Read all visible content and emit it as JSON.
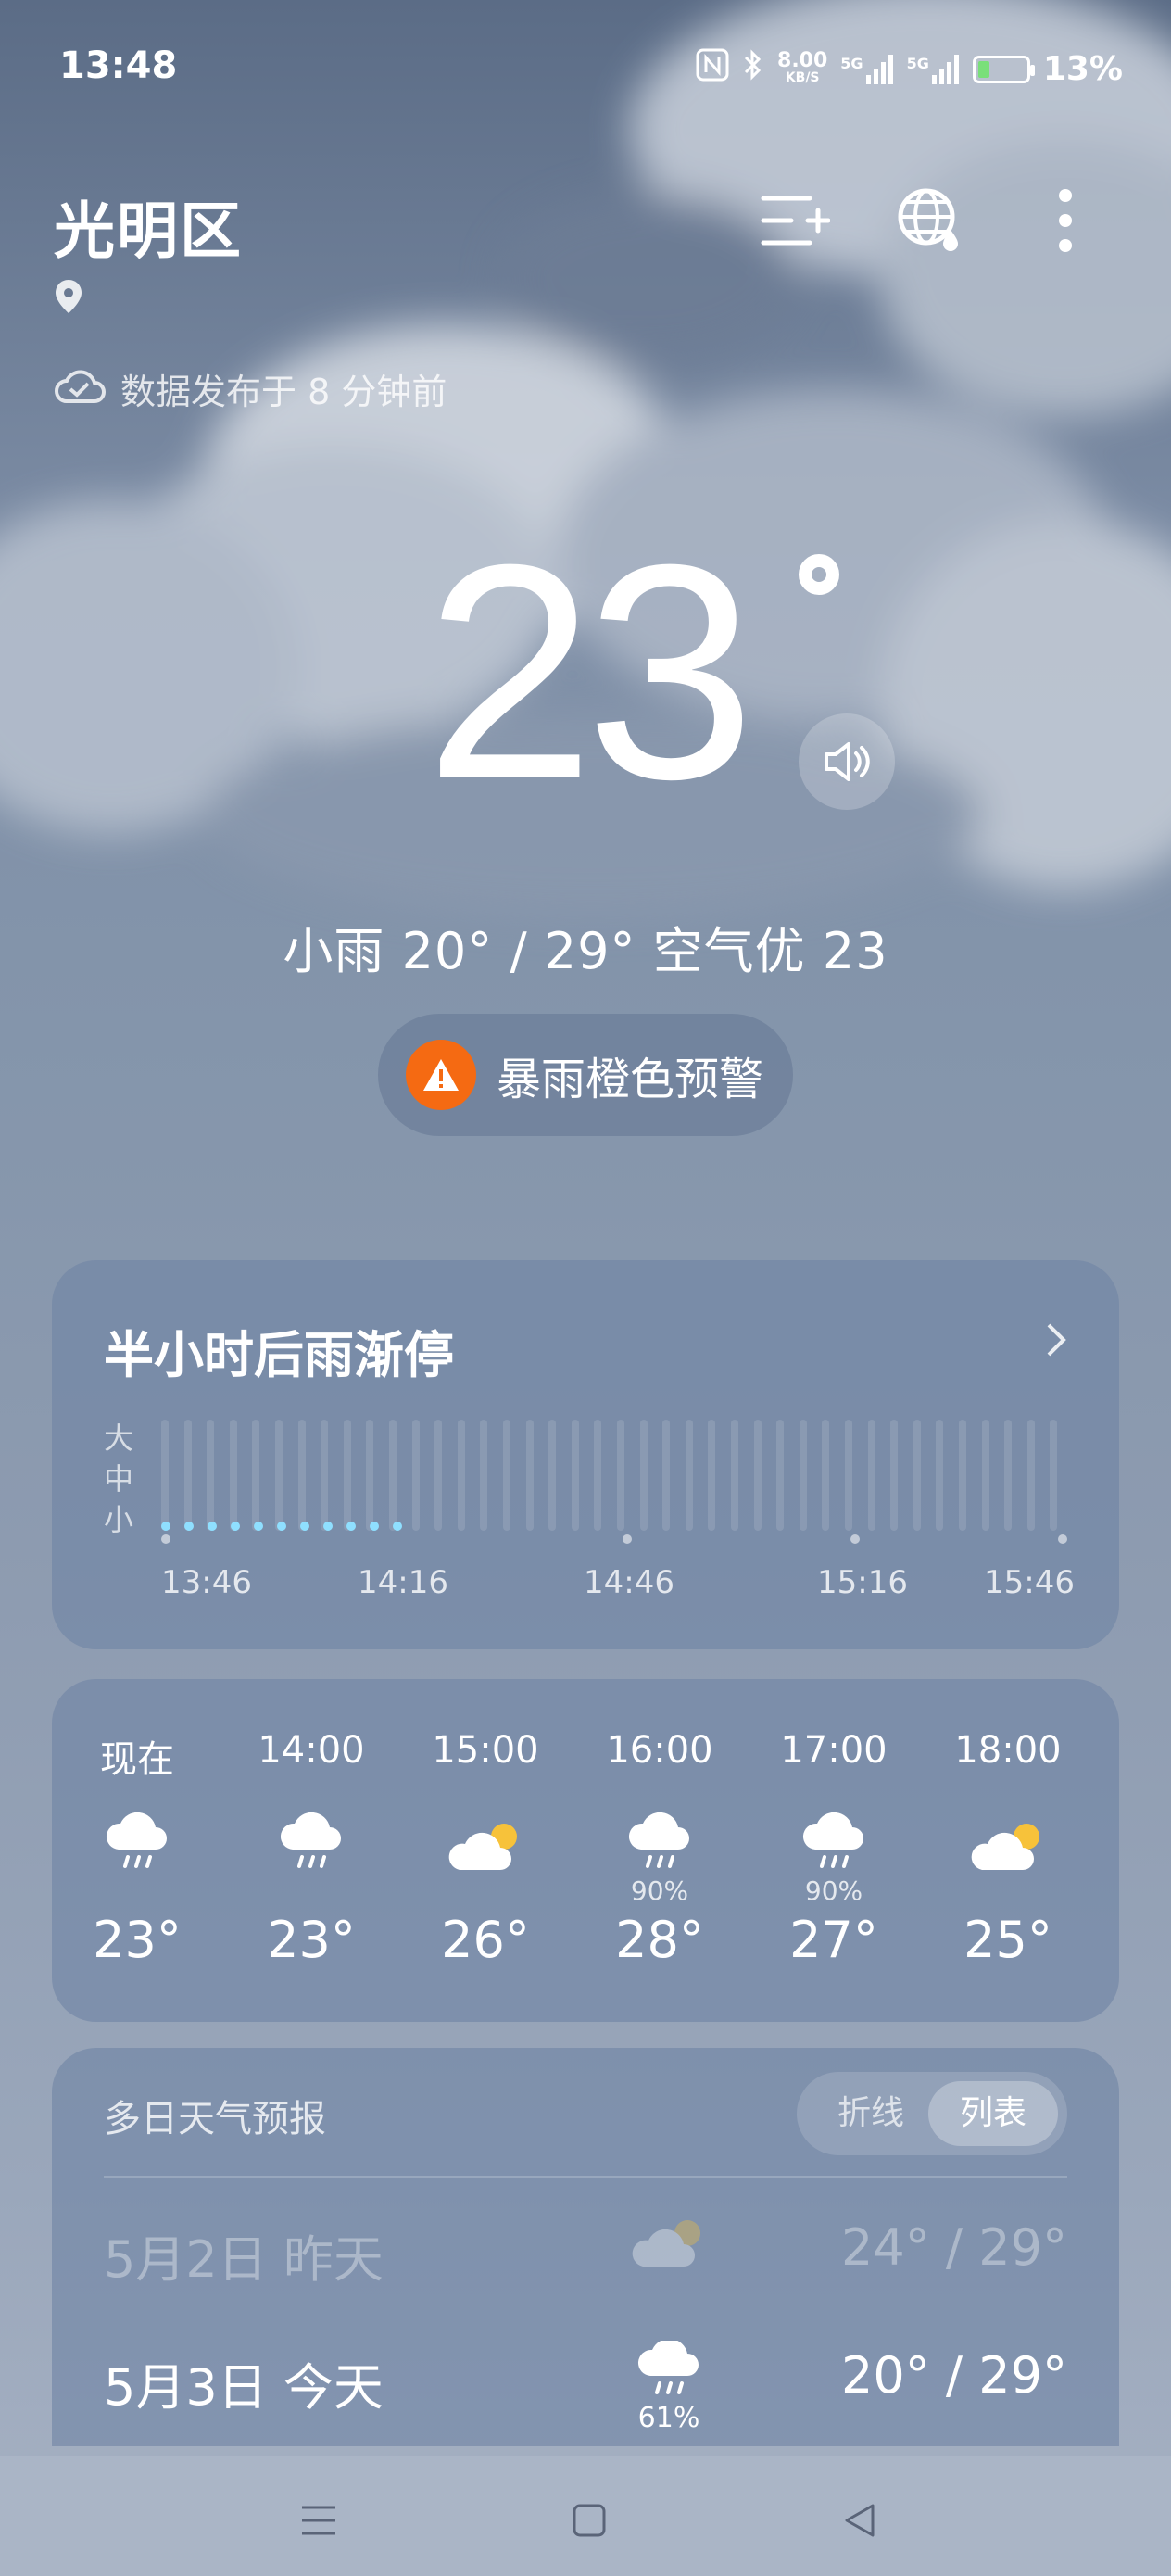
{
  "status_bar": {
    "time": "13:48",
    "net_speed": "8.00",
    "net_unit": "KB/S",
    "sim1": "5G",
    "sim2": "5G",
    "battery": "13%"
  },
  "header": {
    "city": "光明区",
    "update_text": "数据发布于 8 分钟前"
  },
  "current": {
    "temperature": "23",
    "condition_line": "小雨  20° / 29°  空气优 23",
    "alert": "暴雨橙色预警"
  },
  "rain_card": {
    "title": "半小时后雨渐停",
    "levels": [
      "大",
      "中",
      "小"
    ],
    "times": [
      "13:46",
      "14:16",
      "14:46",
      "15:16",
      "15:46"
    ]
  },
  "hourly": [
    {
      "time": "现在",
      "icon": "rain-icon",
      "pop": "",
      "temp": "23°"
    },
    {
      "time": "14:00",
      "icon": "rain-icon",
      "pop": "",
      "temp": "23°"
    },
    {
      "time": "15:00",
      "icon": "partly-cloudy-icon",
      "pop": "",
      "temp": "26°"
    },
    {
      "time": "16:00",
      "icon": "rain-icon",
      "pop": "90%",
      "temp": "28°"
    },
    {
      "time": "17:00",
      "icon": "rain-icon",
      "pop": "90%",
      "temp": "27°"
    },
    {
      "time": "18:00",
      "icon": "partly-cloudy-icon",
      "pop": "",
      "temp": "25°"
    }
  ],
  "forecast": {
    "title": "多日天气预报",
    "toggle_line": "折线",
    "toggle_list": "列表",
    "days": [
      {
        "date": "5月2日  昨天",
        "icon": "partly-cloudy-icon",
        "pop": "",
        "range": "24° / 29°"
      },
      {
        "date": "5月3日  今天",
        "icon": "rain-icon",
        "pop": "61%",
        "range": "20° / 29°"
      }
    ]
  },
  "colors": {
    "alert_orange": "#f56a12",
    "rain_dot": "#8fdfff",
    "sun_yellow": "#f7c23a"
  }
}
